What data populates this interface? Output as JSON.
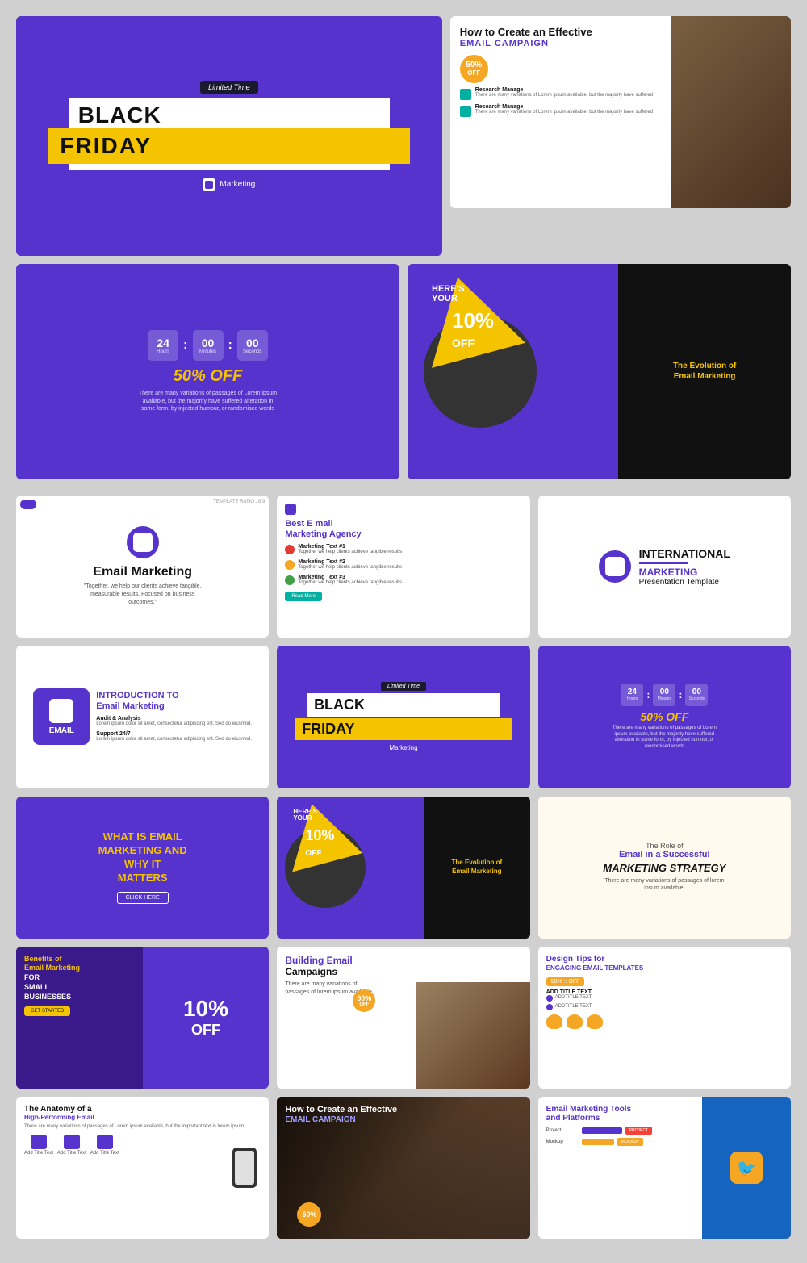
{
  "slides": {
    "s1": {
      "limited_time": "Limited Time",
      "black": "BLACK",
      "friday": "FRIDAY",
      "brand": "Marketing"
    },
    "s2": {
      "title": "How to Create an Effective",
      "subtitle": "EMAIL CAMPAIGN",
      "badge": "50% OFF",
      "item1_title": "Research Manage",
      "item1_desc": "There are many variations of Lorem ipsum available, but the majority have suffered",
      "item2_title": "Research Manage",
      "item2_desc": "There are many variations of Lorem ipsum available, but the majority have suffered"
    },
    "s3": {
      "hours": "24",
      "minutes": "00",
      "seconds": "00",
      "hours_label": "Hours",
      "minutes_label": "Minutes",
      "seconds_label": "Seconds",
      "discount": "50% OFF",
      "desc": "There are many variations of passages of Lorem ipsum available, but the majority have suffered alteration in some form, by injected humour, or randomised words"
    },
    "s4": {
      "heres": "HERE'S",
      "your": "YOUR",
      "percent": "10%",
      "off": "OFF",
      "evolution": "The Evolution of",
      "email_marketing": "Email Marketing"
    },
    "s5": {
      "title": "Email Marketing",
      "subtitle": "\"Together, we help our clients achieve tangible, measurable results. Focused on business outcomes.\""
    },
    "s6": {
      "brand_title": "Best E mail Marketing Agency",
      "item1_label": "Marketing Text #1",
      "item1_desc": "Together we help clients achieve tangible results",
      "item2_label": "Marketing Text #2",
      "item2_desc": "Together we help clients achieve tangible results",
      "item3_label": "Marketing Text #3",
      "item3_desc": "Together we help clients achieve tangible results",
      "read_more": "Read More"
    },
    "s7": {
      "title1": "INTERNATIONAL",
      "title2": "MARKETING",
      "title3": "Presentation Template"
    },
    "s8": {
      "intro_label": "INTRODUCTION TO",
      "title_line1": "Email",
      "title_line2": "Marketing",
      "email_label": "EMAIL",
      "item1_title": "Audit & Analysis",
      "item1_desc": "Lorem ipsum dolor sit amet, consectetur adipiscing elit. Sed do eiusmod.",
      "item2_title": "Support 24/7",
      "item2_desc": "Lorem ipsum dolor sit amet, consectetur adipiscing elit. Sed do eiusmod."
    },
    "s9": {
      "limited_time": "Limited Time",
      "black": "BLACK",
      "friday": "FRIDAY",
      "brand": "Marketing"
    },
    "s10": {
      "hours": "24",
      "minutes": "00",
      "seconds": "00",
      "hours_label": "Hours",
      "minutes_label": "Minutes",
      "seconds_label": "Seconds",
      "discount": "50% OFF",
      "desc": "There are many variations of passages of Lorem ipsum available, but the majority have suffered alteration in some form, by injected humour, or randomised words"
    },
    "s11": {
      "line1": "WHAT IS EMAIL",
      "line2": "MARKETING AND",
      "line3": "WHY IT",
      "line4": "MATTERS",
      "btn": "CLICK HERE"
    },
    "s12": {
      "heres": "HERE'S",
      "your": "YOUR",
      "percent": "10%",
      "off": "OFF",
      "evolution": "The Evolution of",
      "email_marketing": "Email Marketing"
    },
    "s13": {
      "role1": "The Role of",
      "role2": "Email in a Successful",
      "role3": "MARKETING STRATEGY",
      "desc": "There are many variations of passages of lorem ipsum available."
    },
    "s14": {
      "title1": "Benefits of",
      "title2": "Email Marketing",
      "title3": "FOR",
      "title4": "SMALL",
      "title5": "BUSINESSES",
      "pct": "10%",
      "off": "OFF",
      "btn": "GET STARTED"
    },
    "s15": {
      "title": "Building Email Campaigns",
      "title_em": "Email",
      "desc": "There are many variations of passages of lorem ipsum available.",
      "pct": "50%",
      "off": "OFF"
    },
    "s16": {
      "title": "Design Tips for",
      "subtitle": "ENGAGING EMAIL TEMPLATES",
      "badge": "50% :: OFF",
      "add_title": "ADD TITLE TEXT",
      "item1_title": "ADDTITLE TEXT",
      "item2_title": "ADDTITLE TEXT"
    },
    "s17": {
      "title": "The Anatomy of a",
      "subtitle": "High-Performing Email",
      "desc": "There are many variations of passages of Lorem ipsum available, but the important text is lorem ipsum.",
      "label1": "Add Title Text",
      "label2": "Add Title Text",
      "label3": "Add Title Text"
    },
    "s18": {
      "title": "How to Create an Effective",
      "subtitle": "EMAIL CAMPAIGN",
      "pct": "50%"
    },
    "s19": {
      "title": "Email Marketing Tools and Platforms",
      "project": "PROJECT",
      "mockup": "MOCKUP"
    }
  }
}
